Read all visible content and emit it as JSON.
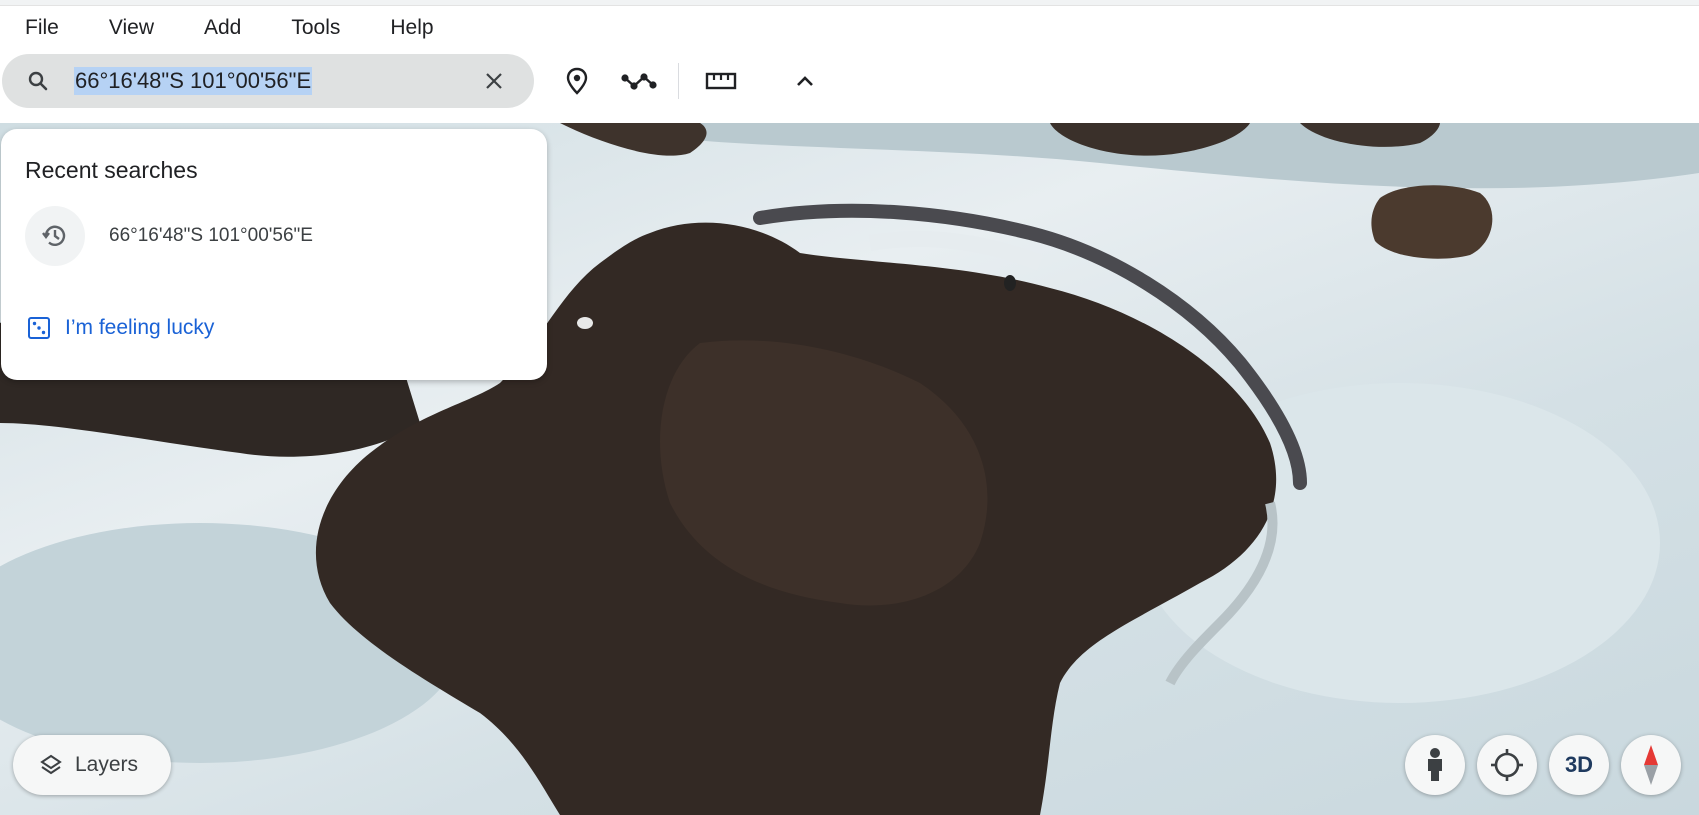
{
  "menu": {
    "items": [
      "File",
      "View",
      "Add",
      "Tools",
      "Help"
    ]
  },
  "search": {
    "value": "66°16'48\"S 101°00'56\"E"
  },
  "dropdown": {
    "heading": "Recent searches",
    "recent": [
      "66°16'48\"S 101°00'56\"E"
    ],
    "lucky_label": "I’m feeling lucky"
  },
  "controls": {
    "layers_label": "Layers",
    "three_d_label": "3D"
  },
  "icons": [
    "search-icon",
    "clear-icon",
    "placemark-icon",
    "path-icon",
    "ruler-icon",
    "chevron-up-icon",
    "history-icon",
    "dice-icon",
    "layers-icon",
    "pegman-icon",
    "my-location-icon",
    "compass-icon"
  ],
  "colors": {
    "accent": "#1a62d6",
    "search_bg": "#dfe1e1",
    "selection": "#b6d2f4"
  }
}
